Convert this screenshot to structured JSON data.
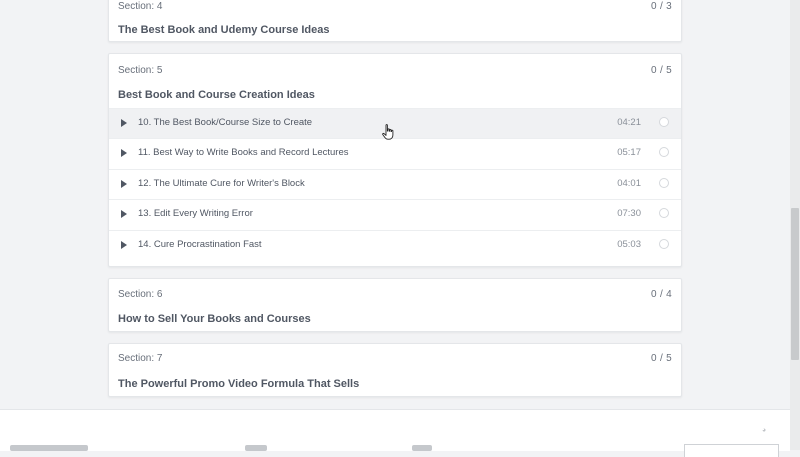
{
  "sections": [
    {
      "label": "Section: 4",
      "count": "0 / 3",
      "title": "The Best Book and Udemy Course Ideas"
    },
    {
      "label": "Section: 5",
      "count": "0 / 5",
      "title": "Best Book and Course Creation Ideas",
      "lectures": [
        {
          "title": "10. The Best Book/Course Size to Create",
          "duration": "04:21"
        },
        {
          "title": "11. Best Way to Write Books and Record Lectures",
          "duration": "05:17"
        },
        {
          "title": "12. The Ultimate Cure for Writer's Block",
          "duration": "04:01"
        },
        {
          "title": "13. Edit Every Writing Error",
          "duration": "07:30"
        },
        {
          "title": "14. Cure Procrastination Fast",
          "duration": "05:03"
        }
      ]
    },
    {
      "label": "Section: 6",
      "count": "0 / 4",
      "title": "How to Sell Your Books and Courses"
    },
    {
      "label": "Section: 7",
      "count": "0 / 5",
      "title": "The Powerful Promo Video Formula That Sells"
    }
  ],
  "icons": {
    "play": "play-icon",
    "complete": "circle-check-icon",
    "cursor": "hand-pointer-icon"
  },
  "colors": {
    "background": "#f2f3f5",
    "card": "#ffffff",
    "active_row": "#f0f1f3",
    "text": "#505763"
  }
}
